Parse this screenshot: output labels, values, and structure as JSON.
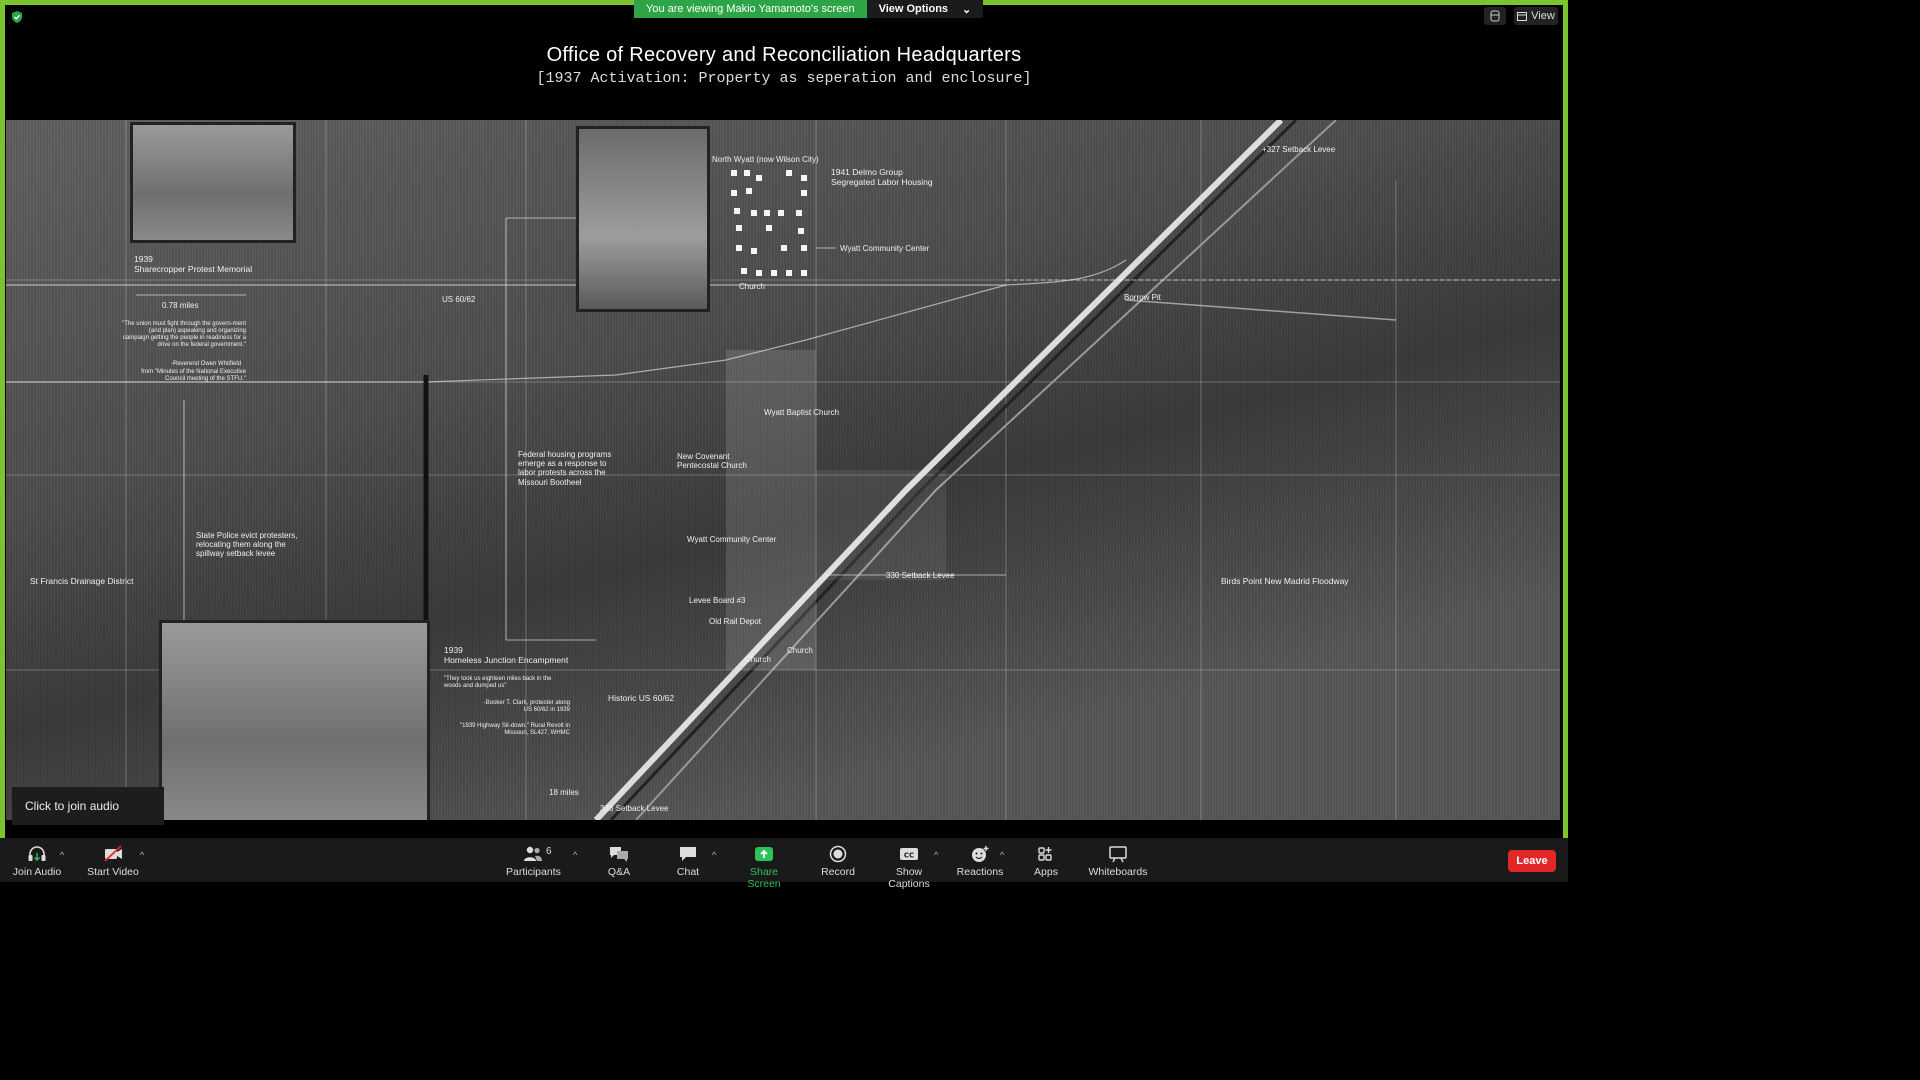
{
  "meeting": {
    "banner_text": "You are viewing Makio Yamamoto's screen",
    "view_options_label": "View Options",
    "view_label": "View",
    "join_audio_prompt": "Click to join audio"
  },
  "slide": {
    "title": "Office of Recovery and Reconciliation  Headquarters",
    "subtitle": "[1937 Activation: Property as seperation and enclosure]"
  },
  "map_labels": {
    "north_wyatt": "North Wyatt (now Wilson City)",
    "delmo_group": "1941 Delmo Group",
    "delmo_group_2": "Segregated Labor Housing",
    "wyatt_community_center_top": "Wyatt Community Center",
    "church_top": "Church",
    "us_60_62": "US 60/62",
    "borrow_pit": "Borrow Pit",
    "setback_levee_327": "+327  Setback Levee",
    "sharecropper_year": "1939",
    "sharecropper_title": "Sharecropper Protest Memorial",
    "distance_078": "0.78 miles",
    "union_quote": "\"The union must fight through the govern-ment (and plan) aspeaking and organizing campaign getting the people in readiness for a drive on the federal government.\"",
    "union_attrib": "-Reverend Owen Whitfield",
    "union_source": "from \"Minutes of the National Executive Council meeting of the STFU.\"",
    "wyatt_baptist": "Wyatt Baptist Church",
    "new_covenant": "New Covenant",
    "pentecostal": "Pentecostal Church",
    "federal_housing": "Federal housing programs emerge as a response to labor protests across the Missouri Bootheel",
    "wyatt_community_center_mid": "Wyatt Community Center",
    "state_police": "State Police evict protesters, relocating them along the spillway setback levee",
    "st_francis": "St Francis Drainage District",
    "setback_levee_330": "330  Setback Levee",
    "birds_point": "Birds Point New Madrid Floodway",
    "levee_board": "Levee Board #3",
    "old_rail_depot": "Old Rail Depot",
    "church_lower": "Church",
    "church_lower_2": "Church",
    "homeless_year": "1939",
    "homeless_title": "Homeless Junction Encampment",
    "eighteen_quote": "\"They took us eighteen miles back in the woods and dumped us\"",
    "clark_attrib": "-Booker T. Clark, protester along US 60/62 in 1939",
    "revolt_source": "\"1939 Highway Sit-down,\" Rural Revolt in Missouri, SL427, WHMC",
    "historic_us": "Historic US 60/62",
    "eighteen_miles": "18 miles",
    "setback_levee_328": "328   Setback Levee"
  },
  "toolbar": {
    "join_audio": "Join Audio",
    "start_video": "Start Video",
    "participants": "Participants",
    "participants_count": "6",
    "qa": "Q&A",
    "chat": "Chat",
    "share_screen": "Share Screen",
    "record": "Record",
    "show_captions": "Show Captions",
    "reactions": "Reactions",
    "apps": "Apps",
    "whiteboards": "Whiteboards",
    "leave": "Leave"
  },
  "colors": {
    "share_border": "#7cc42e",
    "banner_green": "#2da446",
    "leave_red": "#e02828",
    "share_icon_green": "#2ec25a"
  }
}
